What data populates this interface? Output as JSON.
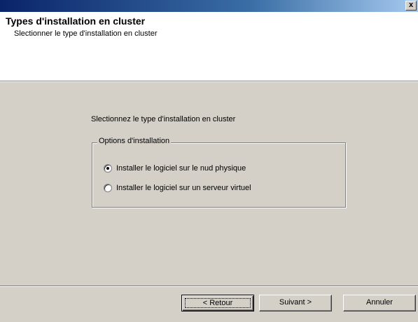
{
  "window": {
    "close_label": "x"
  },
  "header": {
    "title": "Types d'installation en cluster",
    "subtitle": "Slectionner le type d'installation en cluster"
  },
  "main": {
    "prompt": "Slectionnez le type d'installation en cluster",
    "group_label": "Options d'installation",
    "options": [
      {
        "label": "Installer le logiciel sur le nud physique",
        "checked": true
      },
      {
        "label": "Installer le logiciel sur un serveur virtuel",
        "checked": false
      }
    ]
  },
  "buttons": {
    "back": "< Retour",
    "next": "Suivant >",
    "cancel": "Annuler"
  }
}
